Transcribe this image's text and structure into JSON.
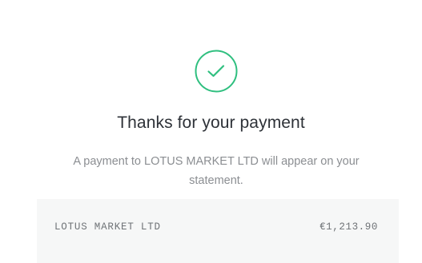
{
  "confirmation": {
    "icon": "checkmark-circle-icon",
    "accent_color": "#2fbf7f",
    "title": "Thanks for your payment",
    "message": "A payment to LOTUS MARKET LTD will appear on your statement."
  },
  "summary": {
    "merchant": "LOTUS MARKET LTD",
    "amount": "€1,213.90"
  }
}
